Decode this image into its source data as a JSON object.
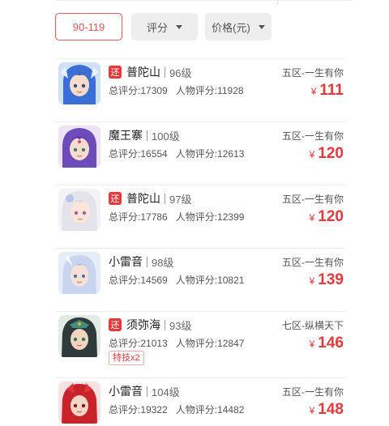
{
  "filters": {
    "price_range": "90-119",
    "score": "评分",
    "price": "价格(元)"
  },
  "colors": {
    "accent": "#e5393b",
    "chip_bg": "#eeeeee"
  },
  "listings": [
    {
      "tag": "还",
      "server": "普陀山",
      "level": "96级",
      "total_label": "总评分:",
      "total": "17309",
      "char_label": "人物评分:",
      "char": "11928",
      "region": "五区-一生有你",
      "currency": "¥",
      "price": "111",
      "avatar": "blue-hair-character-icon"
    },
    {
      "tag": "",
      "server": "魔王寨",
      "level": "100级",
      "total_label": "总评分:",
      "total": "16554",
      "char_label": "人物评分:",
      "char": "12613",
      "region": "五区-一生有你",
      "currency": "¥",
      "price": "120",
      "avatar": "purple-hair-character-icon"
    },
    {
      "tag": "还",
      "server": "普陀山",
      "level": "97级",
      "total_label": "总评分:",
      "total": "17786",
      "char_label": "人物评分:",
      "char": "12399",
      "region": "五区-一生有你",
      "currency": "¥",
      "price": "120",
      "avatar": "white-hair-character-icon"
    },
    {
      "tag": "",
      "server": "小雷音",
      "level": "98级",
      "total_label": "总评分:",
      "total": "14569",
      "char_label": "人物评分:",
      "char": "10821",
      "region": "五区-一生有你",
      "currency": "¥",
      "price": "139",
      "avatar": "silver-hair-character-icon"
    },
    {
      "tag": "还",
      "server": "须弥海",
      "level": "93级",
      "total_label": "总评分:",
      "total": "21013",
      "char_label": "人物评分:",
      "char": "12847",
      "skill": "特技x2",
      "region": "七区-纵横天下",
      "currency": "¥",
      "price": "146",
      "avatar": "dark-hair-character-icon"
    },
    {
      "tag": "",
      "server": "小雷音",
      "level": "104级",
      "total_label": "总评分:",
      "total": "19322",
      "char_label": "人物评分:",
      "char": "14482",
      "region": "五区-一生有你",
      "currency": "¥",
      "price": "148",
      "avatar": "red-hair-character-icon"
    }
  ]
}
